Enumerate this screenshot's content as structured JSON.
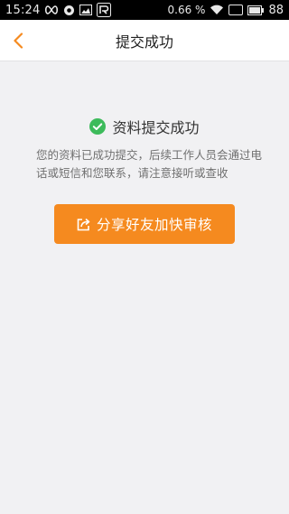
{
  "status_bar": {
    "time": "15:24",
    "signal_percent": "0.66 %",
    "battery": "88"
  },
  "header": {
    "title": "提交成功"
  },
  "main": {
    "success_text": "资料提交成功",
    "description": "您的资料已成功提交，后续工作人员会通过电话或短信和您联系，请注意接听或查收",
    "share_button_label": "分享好友加快审核"
  },
  "colors": {
    "accent": "#f58a1f",
    "success": "#3dbb5b",
    "background": "#f1f1f3"
  },
  "icons": {
    "back": "chevron-left-icon",
    "success": "check-circle-icon",
    "share": "share-icon"
  }
}
